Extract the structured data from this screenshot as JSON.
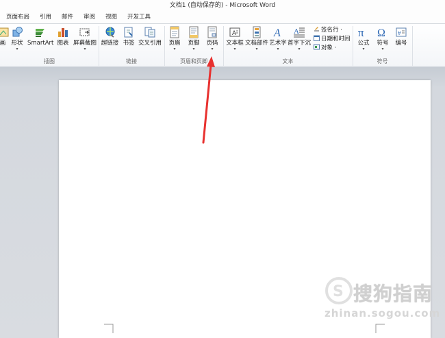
{
  "window": {
    "title": "文档1 (自动保存的) - Microsoft Word"
  },
  "tabs": [
    "页面布局",
    "引用",
    "邮件",
    "审阅",
    "视图",
    "开发工具"
  ],
  "ribbon": {
    "illustrations": {
      "group_label": "插图",
      "items": [
        {
          "label": "画",
          "icon": "drawing-icon"
        },
        {
          "label": "形状",
          "icon": "shapes-icon"
        },
        {
          "label": "SmartArt",
          "icon": "smartart-icon"
        },
        {
          "label": "图表",
          "icon": "chart-icon"
        },
        {
          "label": "屏幕截图",
          "icon": "screenshot-icon"
        }
      ]
    },
    "links": {
      "group_label": "链接",
      "items": [
        {
          "label": "超链接",
          "icon": "hyperlink-icon"
        },
        {
          "label": "书签",
          "icon": "bookmark-icon"
        },
        {
          "label": "交叉引用",
          "icon": "cross-reference-icon"
        }
      ]
    },
    "header_footer": {
      "group_label": "页眉和页脚",
      "items": [
        {
          "label": "页眉",
          "icon": "header-icon"
        },
        {
          "label": "页脚",
          "icon": "footer-icon"
        },
        {
          "label": "页码",
          "icon": "page-number-icon"
        }
      ]
    },
    "text": {
      "group_label": "文本",
      "items": [
        {
          "label": "文本框",
          "icon": "textbox-icon"
        },
        {
          "label": "文档部件",
          "icon": "quick-parts-icon"
        },
        {
          "label": "艺术字",
          "icon": "wordart-icon"
        },
        {
          "label": "首字下沉",
          "icon": "drop-cap-icon"
        }
      ],
      "small_items": [
        {
          "label": "签名行 ·",
          "icon": "signature-line-icon"
        },
        {
          "label": "日期和时间",
          "icon": "date-time-icon"
        },
        {
          "label": "对象 ·",
          "icon": "object-icon"
        }
      ]
    },
    "symbols": {
      "group_label": "符号",
      "items": [
        {
          "label": "公式",
          "icon": "equation-icon"
        },
        {
          "label": "符号",
          "icon": "symbol-icon"
        },
        {
          "label": "编号",
          "icon": "number-icon"
        }
      ]
    }
  },
  "watermark": {
    "text": "搜狗指南",
    "url": "zhinan.sogou.com"
  },
  "colors": {
    "accent": "#2b579a",
    "arrow": "#e8312f"
  }
}
